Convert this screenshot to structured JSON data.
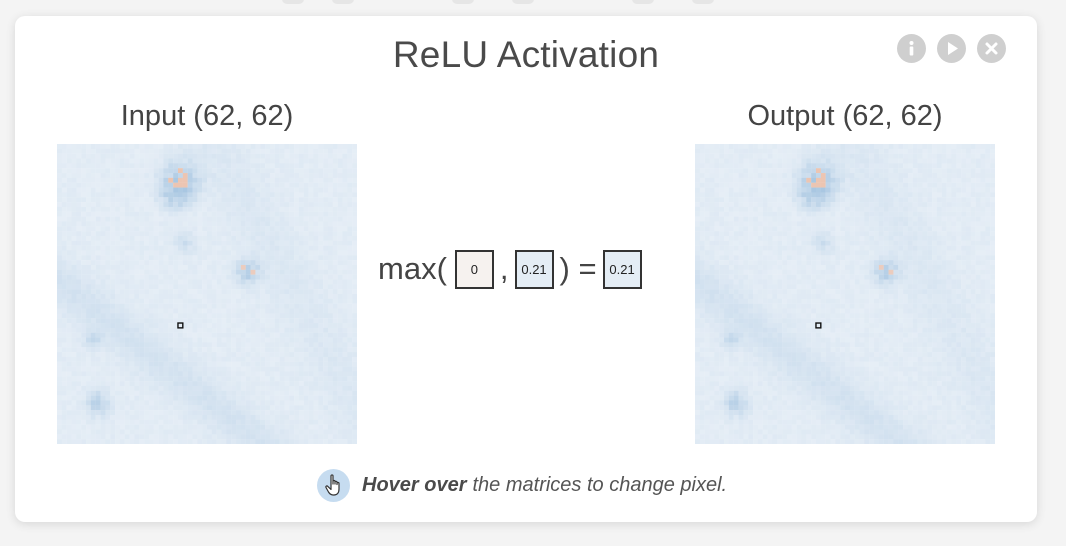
{
  "modal": {
    "title": "ReLU Activation",
    "controls": [
      {
        "icon": "info-icon",
        "label": "info"
      },
      {
        "icon": "play-icon",
        "label": "play"
      },
      {
        "icon": "close-icon",
        "label": "close"
      }
    ]
  },
  "input_panel": {
    "label": "Input (62, 62)"
  },
  "output_panel": {
    "label": "Output (62, 62)"
  },
  "formula": {
    "fn": "max(",
    "first_arg": "0",
    "comma": ",",
    "second_arg": "0.21",
    "close_eq": ") =",
    "result": "0.21"
  },
  "hint": {
    "icon": "hand-pointer-icon",
    "bold": "Hover over",
    "rest": "the matrices to change pixel."
  },
  "colors": {
    "matrix_base": "#e6eef6",
    "matrix_dark": "#a9c7e2",
    "matrix_hot": "#f0a985",
    "control_gray": "#cfcfcf",
    "hint_icon_bg": "#c6dcf0"
  }
}
